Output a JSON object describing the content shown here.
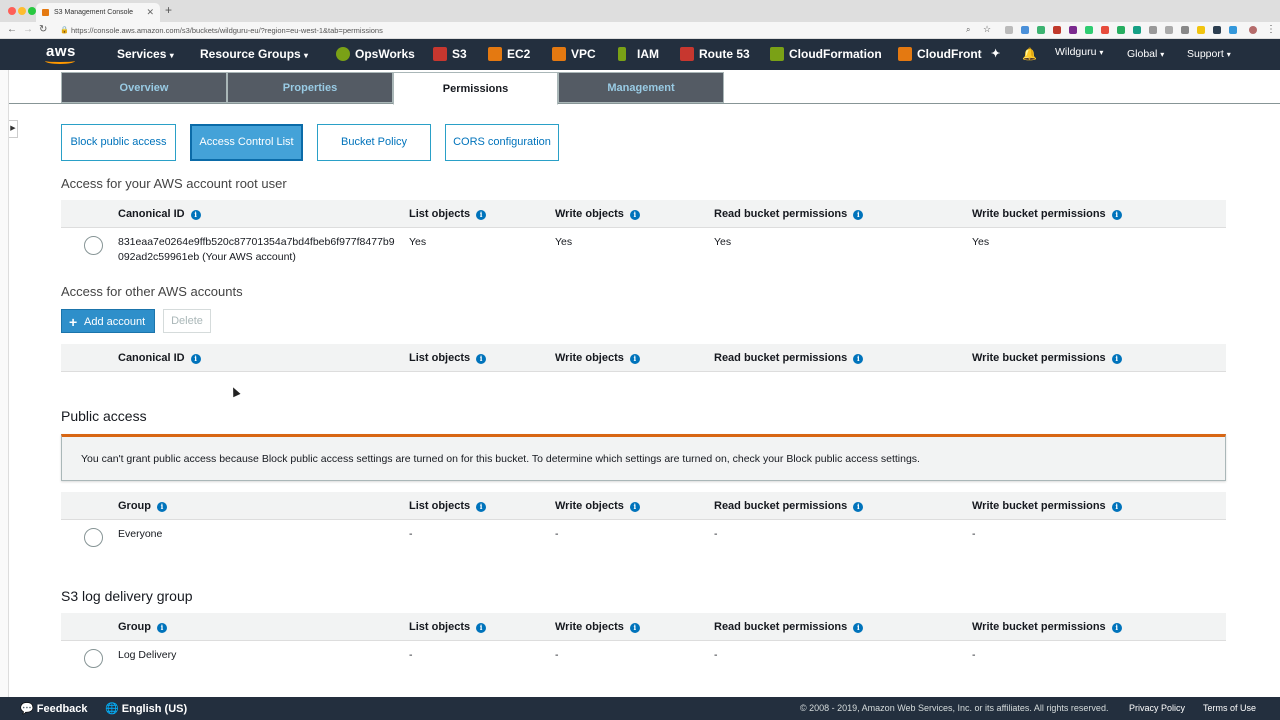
{
  "browser": {
    "tab_title": "S3 Management Console",
    "url": "https://console.aws.amazon.com/s3/buckets/wildguru-eu/?region=eu-west-1&tab=permissions"
  },
  "nav": {
    "logo": "aws",
    "services": "Services",
    "resource_groups": "Resource Groups",
    "shortcuts": [
      "OpsWorks",
      "S3",
      "EC2",
      "VPC",
      "IAM",
      "Route 53",
      "CloudFormation",
      "CloudFront"
    ],
    "account": "Wildguru",
    "region": "Global",
    "support": "Support"
  },
  "tabs": [
    "Overview",
    "Properties",
    "Permissions",
    "Management"
  ],
  "subtabs": [
    "Block public access",
    "Access Control List",
    "Bucket Policy",
    "CORS configuration"
  ],
  "root_section": {
    "title": "Access for your AWS account root user",
    "headers": [
      "Canonical ID",
      "List objects",
      "Write objects",
      "Read bucket permissions",
      "Write bucket permissions"
    ],
    "row": {
      "id_line1": "831eaa7e0264e9ffb520c87701354a7bd4fbeb6f977f8477b9",
      "id_line2": "092ad2c59961eb (Your AWS account)",
      "list": "Yes",
      "write": "Yes",
      "read_perm": "Yes",
      "write_perm": "Yes"
    }
  },
  "other_section": {
    "title": "Access for other AWS accounts",
    "add_button": "Add account",
    "delete_button": "Delete",
    "headers": [
      "Canonical ID",
      "List objects",
      "Write objects",
      "Read bucket permissions",
      "Write bucket permissions"
    ]
  },
  "public_section": {
    "title": "Public access",
    "alert": "You can't grant public access because Block public access settings are turned on for this bucket. To determine which settings are turned on, check your Block public access settings.",
    "headers": [
      "Group",
      "List objects",
      "Write objects",
      "Read bucket permissions",
      "Write bucket permissions"
    ],
    "row": {
      "group": "Everyone",
      "list": "-",
      "write": "-",
      "read_perm": "-",
      "write_perm": "-"
    }
  },
  "log_section": {
    "title": "S3 log delivery group",
    "headers": [
      "Group",
      "List objects",
      "Write objects",
      "Read bucket permissions",
      "Write bucket permissions"
    ],
    "row": {
      "group": "Log Delivery",
      "list": "-",
      "write": "-",
      "read_perm": "-",
      "write_perm": "-"
    }
  },
  "footer": {
    "feedback": "Feedback",
    "language": "English (US)",
    "copyright": "© 2008 - 2019, Amazon Web Services, Inc. or its affiliates. All rights reserved.",
    "privacy": "Privacy Policy",
    "terms": "Terms of Use"
  },
  "colors": {
    "nav_bg": "#232f3e",
    "accent": "#0073bb",
    "alert_border": "#d86613",
    "primary_btn": "#2e8fca"
  }
}
